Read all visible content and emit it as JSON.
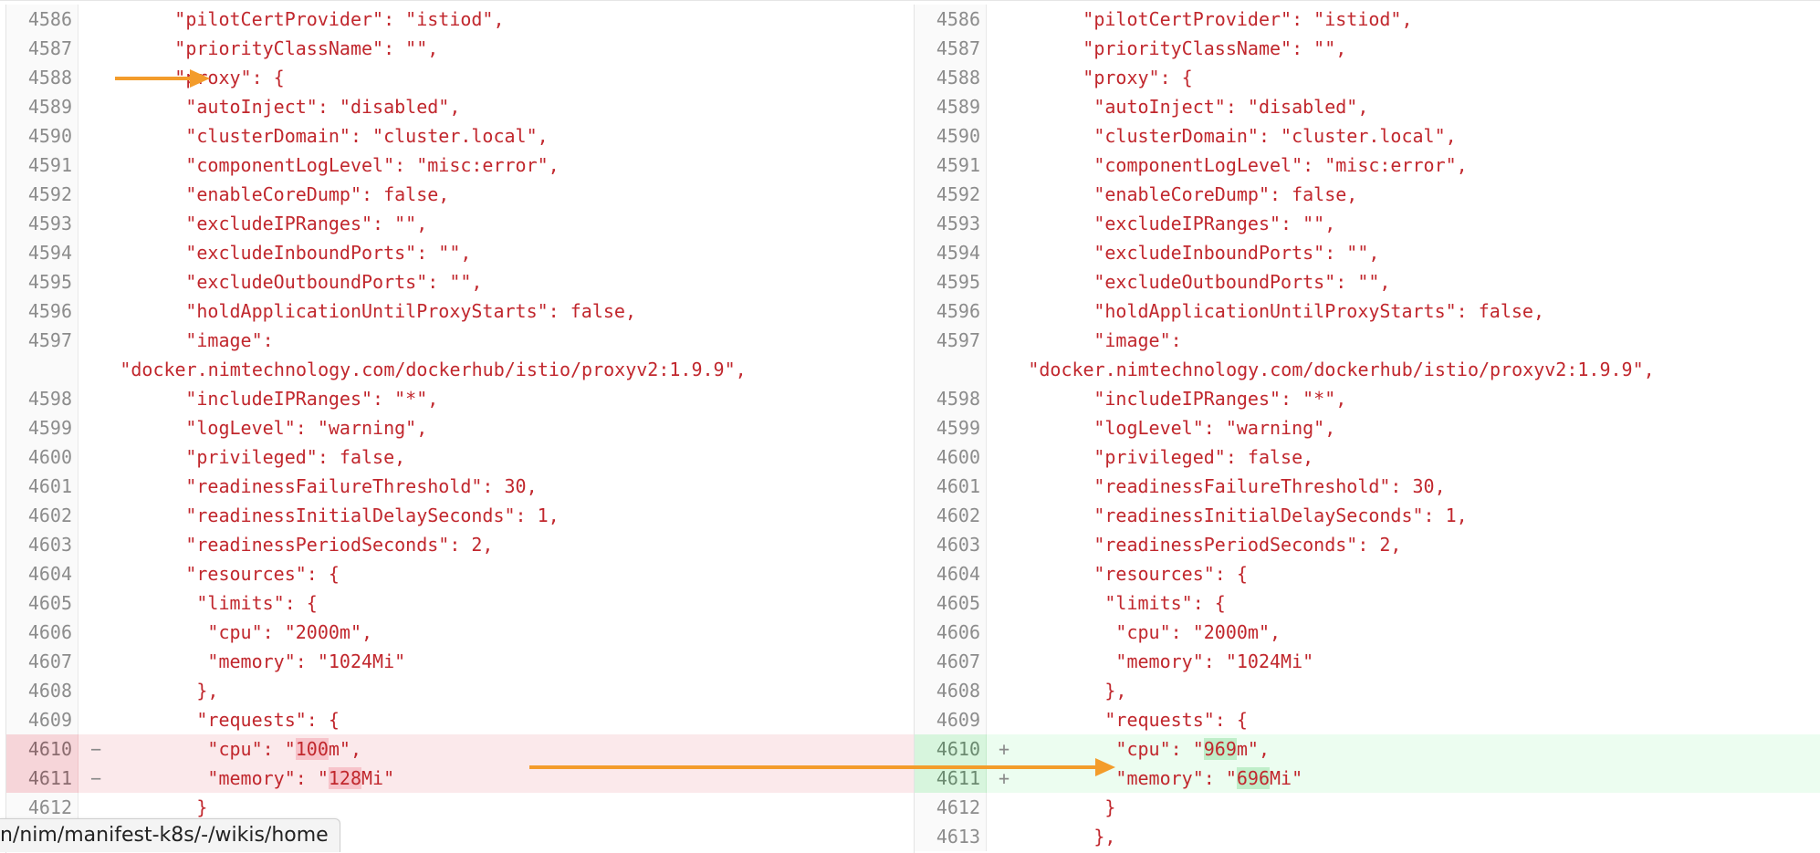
{
  "status_url": "n/nim/manifest-k8s/-/wikis/home",
  "colors": {
    "code_text": "#c1272d",
    "deleted_bg": "#fbe9eb",
    "added_bg": "#ecfdf0",
    "arrow": "#f39c2b"
  },
  "left_pane": [
    {
      "num": "4586",
      "indent": 7,
      "text": "\"pilotCertProvider\": \"istiod\",",
      "type": "ctx"
    },
    {
      "num": "4587",
      "indent": 7,
      "text": "\"priorityClassName\": \"\",",
      "type": "ctx"
    },
    {
      "num": "4588",
      "indent": 7,
      "text": "\"proxy\": {",
      "type": "ctx"
    },
    {
      "num": "4589",
      "indent": 8,
      "text": "\"autoInject\": \"disabled\",",
      "type": "ctx"
    },
    {
      "num": "4590",
      "indent": 8,
      "text": "\"clusterDomain\": \"cluster.local\",",
      "type": "ctx"
    },
    {
      "num": "4591",
      "indent": 8,
      "text": "\"componentLogLevel\": \"misc:error\",",
      "type": "ctx"
    },
    {
      "num": "4592",
      "indent": 8,
      "text": "\"enableCoreDump\": false,",
      "type": "ctx"
    },
    {
      "num": "4593",
      "indent": 8,
      "text": "\"excludeIPRanges\": \"\",",
      "type": "ctx"
    },
    {
      "num": "4594",
      "indent": 8,
      "text": "\"excludeInboundPorts\": \"\",",
      "type": "ctx"
    },
    {
      "num": "4595",
      "indent": 8,
      "text": "\"excludeOutboundPorts\": \"\",",
      "type": "ctx"
    },
    {
      "num": "4596",
      "indent": 8,
      "text": "\"holdApplicationUntilProxyStarts\": false,",
      "type": "ctx"
    },
    {
      "num": "4597",
      "indent": 8,
      "text": "\"image\":",
      "type": "ctx",
      "wrap": "\"docker.nimtechnology.com/dockerhub/istio/proxyv2:1.9.9\","
    },
    {
      "num": "4598",
      "indent": 8,
      "text": "\"includeIPRanges\": \"*\",",
      "type": "ctx"
    },
    {
      "num": "4599",
      "indent": 8,
      "text": "\"logLevel\": \"warning\",",
      "type": "ctx"
    },
    {
      "num": "4600",
      "indent": 8,
      "text": "\"privileged\": false,",
      "type": "ctx"
    },
    {
      "num": "4601",
      "indent": 8,
      "text": "\"readinessFailureThreshold\": 30,",
      "type": "ctx"
    },
    {
      "num": "4602",
      "indent": 8,
      "text": "\"readinessInitialDelaySeconds\": 1,",
      "type": "ctx"
    },
    {
      "num": "4603",
      "indent": 8,
      "text": "\"readinessPeriodSeconds\": 2,",
      "type": "ctx"
    },
    {
      "num": "4604",
      "indent": 8,
      "text": "\"resources\": {",
      "type": "ctx"
    },
    {
      "num": "4605",
      "indent": 9,
      "text": "\"limits\": {",
      "type": "ctx"
    },
    {
      "num": "4606",
      "indent": 10,
      "text": "\"cpu\": \"2000m\",",
      "type": "ctx"
    },
    {
      "num": "4607",
      "indent": 10,
      "text": "\"memory\": \"1024Mi\"",
      "type": "ctx"
    },
    {
      "num": "4608",
      "indent": 9,
      "text": "},",
      "type": "ctx"
    },
    {
      "num": "4609",
      "indent": 9,
      "text": "\"requests\": {",
      "type": "ctx"
    },
    {
      "num": "4610",
      "indent": 10,
      "pre": "\"cpu\": \"",
      "hl": "100",
      "post": "m\",",
      "type": "del",
      "mark": "−"
    },
    {
      "num": "4611",
      "indent": 10,
      "pre": "\"memory\": \"",
      "hl": "128",
      "post": "Mi\"",
      "type": "del",
      "mark": "−"
    },
    {
      "num": "4612",
      "indent": 9,
      "text": "}",
      "type": "ctx"
    }
  ],
  "right_pane": [
    {
      "num": "4586",
      "indent": 7,
      "text": "\"pilotCertProvider\": \"istiod\",",
      "type": "ctx"
    },
    {
      "num": "4587",
      "indent": 7,
      "text": "\"priorityClassName\": \"\",",
      "type": "ctx"
    },
    {
      "num": "4588",
      "indent": 7,
      "text": "\"proxy\": {",
      "type": "ctx"
    },
    {
      "num": "4589",
      "indent": 8,
      "text": "\"autoInject\": \"disabled\",",
      "type": "ctx"
    },
    {
      "num": "4590",
      "indent": 8,
      "text": "\"clusterDomain\": \"cluster.local\",",
      "type": "ctx"
    },
    {
      "num": "4591",
      "indent": 8,
      "text": "\"componentLogLevel\": \"misc:error\",",
      "type": "ctx"
    },
    {
      "num": "4592",
      "indent": 8,
      "text": "\"enableCoreDump\": false,",
      "type": "ctx"
    },
    {
      "num": "4593",
      "indent": 8,
      "text": "\"excludeIPRanges\": \"\",",
      "type": "ctx"
    },
    {
      "num": "4594",
      "indent": 8,
      "text": "\"excludeInboundPorts\": \"\",",
      "type": "ctx"
    },
    {
      "num": "4595",
      "indent": 8,
      "text": "\"excludeOutboundPorts\": \"\",",
      "type": "ctx"
    },
    {
      "num": "4596",
      "indent": 8,
      "text": "\"holdApplicationUntilProxyStarts\": false,",
      "type": "ctx"
    },
    {
      "num": "4597",
      "indent": 8,
      "text": "\"image\":",
      "type": "ctx",
      "wrap": "\"docker.nimtechnology.com/dockerhub/istio/proxyv2:1.9.9\","
    },
    {
      "num": "4598",
      "indent": 8,
      "text": "\"includeIPRanges\": \"*\",",
      "type": "ctx"
    },
    {
      "num": "4599",
      "indent": 8,
      "text": "\"logLevel\": \"warning\",",
      "type": "ctx"
    },
    {
      "num": "4600",
      "indent": 8,
      "text": "\"privileged\": false,",
      "type": "ctx"
    },
    {
      "num": "4601",
      "indent": 8,
      "text": "\"readinessFailureThreshold\": 30,",
      "type": "ctx"
    },
    {
      "num": "4602",
      "indent": 8,
      "text": "\"readinessInitialDelaySeconds\": 1,",
      "type": "ctx"
    },
    {
      "num": "4603",
      "indent": 8,
      "text": "\"readinessPeriodSeconds\": 2,",
      "type": "ctx"
    },
    {
      "num": "4604",
      "indent": 8,
      "text": "\"resources\": {",
      "type": "ctx"
    },
    {
      "num": "4605",
      "indent": 9,
      "text": "\"limits\": {",
      "type": "ctx"
    },
    {
      "num": "4606",
      "indent": 10,
      "text": "\"cpu\": \"2000m\",",
      "type": "ctx"
    },
    {
      "num": "4607",
      "indent": 10,
      "text": "\"memory\": \"1024Mi\"",
      "type": "ctx"
    },
    {
      "num": "4608",
      "indent": 9,
      "text": "},",
      "type": "ctx"
    },
    {
      "num": "4609",
      "indent": 9,
      "text": "\"requests\": {",
      "type": "ctx"
    },
    {
      "num": "4610",
      "indent": 10,
      "pre": "\"cpu\": \"",
      "hl": "969",
      "post": "m\",",
      "type": "add",
      "mark": "+"
    },
    {
      "num": "4611",
      "indent": 10,
      "pre": "\"memory\": \"",
      "hl": "696",
      "post": "Mi\"",
      "type": "add",
      "mark": "+"
    },
    {
      "num": "4612",
      "indent": 9,
      "text": "}",
      "type": "ctx"
    },
    {
      "num": "4613",
      "indent": 8,
      "text": "},",
      "type": "ctx"
    }
  ]
}
